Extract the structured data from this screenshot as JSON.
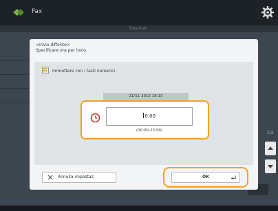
{
  "app": {
    "title": "Fax",
    "icons": {
      "app": "fax-icon",
      "settings": "gear-icon"
    }
  },
  "background": {
    "tab_label": "Destinat.",
    "right_label": "2/2"
  },
  "dialog": {
    "title": "<Invio differito>",
    "subtitle": "Specificare ora per invio.",
    "instruction": "Immettere con i tasti numerici.",
    "datetime": "11/11 2015 18:15",
    "time_value": "0:00",
    "range": "(00:00-23:59)",
    "cancel_label": "Annulla impostaz.",
    "ok_label": "OK"
  },
  "colors": {
    "highlight": "#f2a31d",
    "clock_red": "#d9312b"
  }
}
